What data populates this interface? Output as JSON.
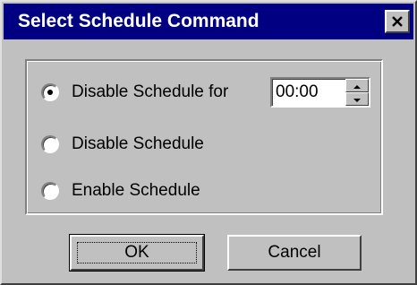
{
  "dialog": {
    "title": "Select Schedule Command",
    "close_icon": "close-icon"
  },
  "options": [
    {
      "label": "Disable Schedule for",
      "selected": true
    },
    {
      "label": "Disable Schedule",
      "selected": false
    },
    {
      "label": "Enable Schedule",
      "selected": false
    }
  ],
  "duration": {
    "value": "00:00"
  },
  "buttons": {
    "ok_label": "OK",
    "cancel_label": "Cancel"
  },
  "colors": {
    "titlebar": "#000080",
    "face": "#c0c0c0"
  }
}
